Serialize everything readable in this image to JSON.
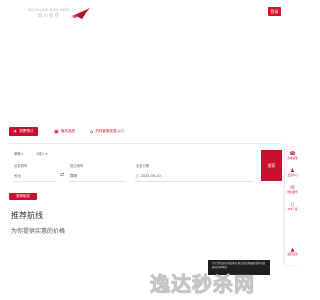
{
  "header": {
    "logo_en": "SICHUAN AIRLINES",
    "logo_cn": "四川航空",
    "login_label": "登录"
  },
  "colors": {
    "accent": "#c8102e"
  },
  "tabs": [
    {
      "label": "机票预订",
      "icon": "plane-icon",
      "active": true
    },
    {
      "label": "值机选座",
      "icon": "seat-icon"
    },
    {
      "label": "热线客服优惠入口",
      "icon": "house-icon"
    }
  ],
  "search": {
    "trip_type": "单程",
    "passengers": "1成人",
    "from_label": "出发城市",
    "to_label": "到达城市",
    "date_label": "出发日期",
    "from_value": "长沙",
    "to_value": "昆明",
    "date_value": "2023-05-10",
    "search_label": "搜索"
  },
  "tag": {
    "label": "推荐航线"
  },
  "section": {
    "title": "推荐航线",
    "subtitle": "为你提供实惠的价格"
  },
  "sidebar": [
    {
      "label": "在线客服",
      "icon": "headset-icon"
    },
    {
      "label": "会员中心",
      "icon": "member-icon"
    },
    {
      "label": "微信服务",
      "icon": "wechat-icon"
    },
    {
      "label": "APP下载",
      "icon": "phone-icon"
    },
    {
      "label": "返回顶部",
      "icon": "arrow-up-icon"
    }
  ],
  "banner": {
    "text": "为了您的良好浏览体验,建议您使用最新版本浏览器访问本网站"
  },
  "watermark": "逸达秒杀网"
}
